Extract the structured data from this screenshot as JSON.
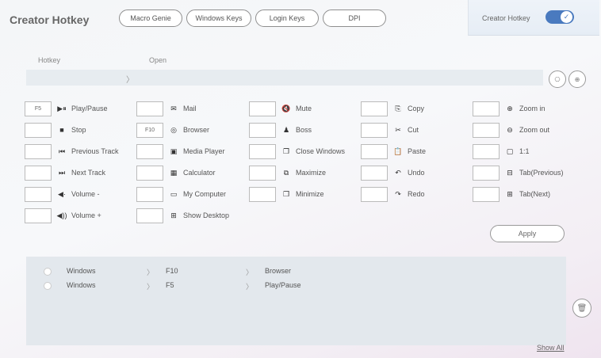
{
  "app": {
    "title": "Creator Hotkey"
  },
  "tabs": [
    "Macro Genie",
    "Windows Keys",
    "Login Keys",
    "DPI"
  ],
  "creator": {
    "label": "Creator Hotkey",
    "enabled": true,
    "check": "✓"
  },
  "columns": {
    "hotkey": "Hotkey",
    "open": "Open"
  },
  "hotkey_bar": {
    "separator": "〉"
  },
  "round_buttons": {
    "left": "⎔",
    "right": "⊕"
  },
  "columns_grid": [
    [
      {
        "key": "F5",
        "icon": "▶⏸",
        "label": "Play/Pause"
      },
      {
        "key": "",
        "icon": "■",
        "label": "Stop"
      },
      {
        "key": "",
        "icon": "⏮",
        "label": "Previous Track"
      },
      {
        "key": "",
        "icon": "⏭",
        "label": "Next Track"
      },
      {
        "key": "",
        "icon": "◀·",
        "label": "Volume -"
      },
      {
        "key": "",
        "icon": "◀))",
        "label": "Volume +"
      }
    ],
    [
      {
        "key": "",
        "icon": "✉",
        "label": "Mail"
      },
      {
        "key": "F10",
        "icon": "◎",
        "label": "Browser"
      },
      {
        "key": "",
        "icon": "▣",
        "label": "Media Player"
      },
      {
        "key": "",
        "icon": "▦",
        "label": "Calculator"
      },
      {
        "key": "",
        "icon": "▭",
        "label": "My Computer"
      },
      {
        "key": "",
        "icon": "⊞",
        "label": "Show Desktop"
      }
    ],
    [
      {
        "key": "",
        "icon": "🔇",
        "label": "Mute"
      },
      {
        "key": "",
        "icon": "♟",
        "label": "Boss"
      },
      {
        "key": "",
        "icon": "❐",
        "label": "Close Windows"
      },
      {
        "key": "",
        "icon": "⧉",
        "label": "Maximize"
      },
      {
        "key": "",
        "icon": "❒",
        "label": "Minimize"
      }
    ],
    [
      {
        "key": "",
        "icon": "⎘",
        "label": "Copy"
      },
      {
        "key": "",
        "icon": "✂",
        "label": "Cut"
      },
      {
        "key": "",
        "icon": "📋",
        "label": "Paste"
      },
      {
        "key": "",
        "icon": "↶",
        "label": "Undo"
      },
      {
        "key": "",
        "icon": "↷",
        "label": "Redo"
      }
    ],
    [
      {
        "key": "",
        "icon": "⊕",
        "label": "Zoom in"
      },
      {
        "key": "",
        "icon": "⊖",
        "label": "Zoom out"
      },
      {
        "key": "",
        "icon": "▢",
        "label": "1:1"
      },
      {
        "key": "",
        "icon": "⊟",
        "label": "Tab(Previous)"
      },
      {
        "key": "",
        "icon": "⊞",
        "label": "Tab(Next)"
      }
    ]
  ],
  "apply_label": "Apply",
  "list": {
    "rows": [
      {
        "modifier": "Windows",
        "key": "F10",
        "action": "Browser"
      },
      {
        "modifier": "Windows",
        "key": "F5",
        "action": "Play/Pause"
      }
    ],
    "separator": "〉"
  },
  "show_all_label": "Show All",
  "trash_icon": "🗑",
  "colors": {
    "toggle": "#4a7abf",
    "list_bg": "#e3e8ed"
  }
}
